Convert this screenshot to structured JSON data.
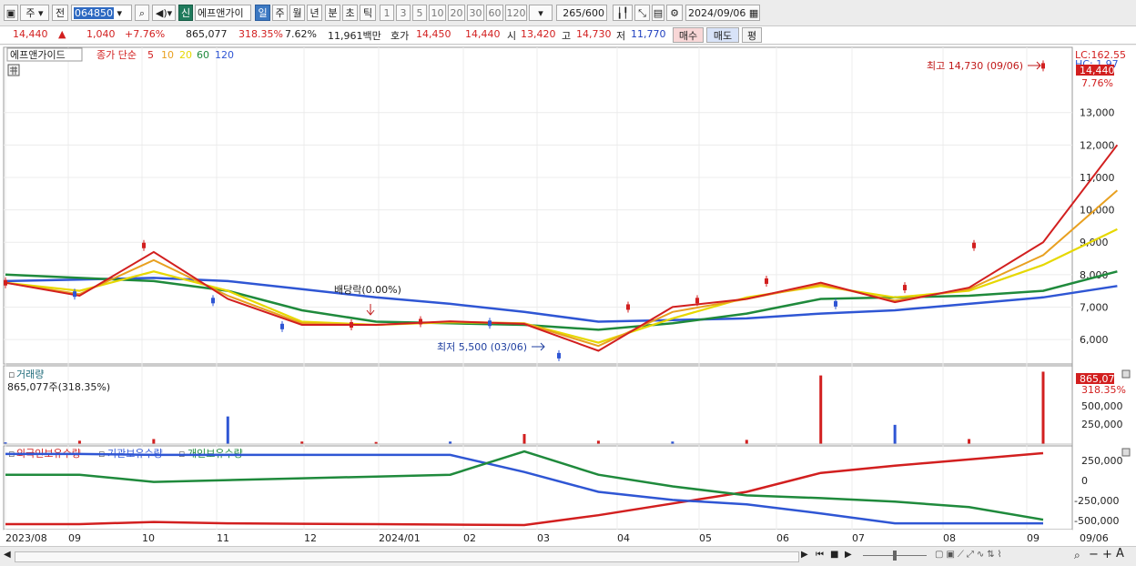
{
  "toolbar": {
    "market": "주",
    "prev": "전",
    "code": "064850",
    "badge": "신",
    "name": "에프앤가이",
    "periods": [
      "일",
      "주",
      "월",
      "년",
      "분",
      "초",
      "틱"
    ],
    "active_period": "일",
    "intervals": [
      "1",
      "3",
      "5",
      "10",
      "20",
      "30",
      "60",
      "120"
    ],
    "count": "265",
    "count_max": "/600",
    "date": "2024/09/06"
  },
  "quote": {
    "price": "14,440",
    "change": "1,040",
    "change_pct": "+7.76%",
    "volume": "865,077",
    "volume_ratio": "318.35%",
    "turnover": "7.62%",
    "amount": "11,961백만",
    "ask_label": "호가",
    "ask": "14,450",
    "bid": "14,440",
    "open_label": "시",
    "open": "13,420",
    "high_label": "고",
    "high": "14,730",
    "low_label": "저",
    "low": "11,770",
    "buy_button": "매수",
    "sell_button": "매도",
    "eval_button": "평"
  },
  "price_panel": {
    "name_tag": "에프앤가이드",
    "legend_prefix": "종가 단순",
    "legend_items": [
      {
        "label": "5",
        "color": "#d21f1f"
      },
      {
        "label": "10",
        "color": "#e8a020"
      },
      {
        "label": "20",
        "color": "#e6d800"
      },
      {
        "label": "60",
        "color": "#1f8a3c"
      },
      {
        "label": "120",
        "color": "#2f56d4"
      }
    ],
    "yaxis_labels": [
      "13,000",
      "12,000",
      "11,000",
      "10,000",
      "9,000",
      "8,000",
      "7,000",
      "6,000"
    ],
    "lc": "LC:162.55",
    "hc": "HC: 1.97",
    "last_tag": "14,440",
    "last_pct": "7.76%",
    "high_annotation": "최고 14,730 (09/06)",
    "low_annotation": "최저 5,500 (03/06)",
    "dividend_annotation": "배당락(0.00%)"
  },
  "volume_panel": {
    "title": "거래량",
    "value_label": "865,077주(318.35%)",
    "yaxis_labels": [
      "500,000",
      "250,000"
    ],
    "last_tag": "865,077",
    "last_pct": "318.35%"
  },
  "holding_panel": {
    "legend": [
      {
        "label": "외국인보유수량",
        "color": "#d21f1f"
      },
      {
        "label": "기관보유수량",
        "color": "#2f56d4"
      },
      {
        "label": "개인보유수량",
        "color": "#1f8a3c"
      }
    ],
    "yaxis_labels": [
      "250,000",
      "0",
      "-250,000",
      "-500,000"
    ]
  },
  "xaxis_labels": [
    "2023/08",
    "09",
    "10",
    "11",
    "12",
    "2024/01",
    "02",
    "03",
    "04",
    "05",
    "06",
    "07",
    "08",
    "09",
    "09/06"
  ],
  "chart_data": [
    {
      "type": "candlestick",
      "title": "에프앤가이드",
      "ylim": [
        5300,
        14900
      ],
      "x": [
        "2023/08",
        "09",
        "10",
        "11",
        "12",
        "2024/01",
        "02",
        "03",
        "04",
        "05",
        "06",
        "07",
        "08",
        "09",
        "09/06"
      ],
      "series": [
        {
          "name": "가격",
          "points": [
            {
              "x": "2023/08",
              "y": 7750
            },
            {
              "x": "09",
              "y": 7400
            },
            {
              "x": "09 중순",
              "y": 8900
            },
            {
              "x": "10",
              "y": 7200
            },
            {
              "x": "11",
              "y": 6400
            },
            {
              "x": "12",
              "y": 6450
            },
            {
              "x": "2024/01",
              "y": 6550
            },
            {
              "x": "02",
              "y": 6500
            },
            {
              "x": "03",
              "y": 5500
            },
            {
              "x": "04",
              "y": 7000
            },
            {
              "x": "05",
              "y": 7200
            },
            {
              "x": "06",
              "y": 7800
            },
            {
              "x": "07",
              "y": 7100
            },
            {
              "x": "08",
              "y": 7600
            },
            {
              "x": "09",
              "y": 8900
            },
            {
              "x": "09/06",
              "y": 14440
            }
          ]
        },
        {
          "name": "5",
          "values": [
            7750,
            7350,
            8700,
            7250,
            6450,
            6450,
            6560,
            6480,
            5650,
            7000,
            7250,
            7750,
            7150,
            7600,
            9000,
            12000
          ]
        },
        {
          "name": "10",
          "values": [
            7750,
            7400,
            8450,
            7350,
            6500,
            6450,
            6550,
            6500,
            5800,
            6850,
            7250,
            7700,
            7200,
            7550,
            8600,
            10600
          ]
        },
        {
          "name": "20",
          "values": [
            7750,
            7500,
            8100,
            7500,
            6550,
            6450,
            6530,
            6500,
            5900,
            6650,
            7300,
            7650,
            7300,
            7500,
            8300,
            9400
          ]
        },
        {
          "name": "60",
          "values": [
            8000,
            7900,
            7800,
            7500,
            6900,
            6550,
            6500,
            6450,
            6300,
            6500,
            6800,
            7250,
            7300,
            7350,
            7500,
            8100
          ]
        },
        {
          "name": "120",
          "values": [
            7800,
            7850,
            7900,
            7800,
            7550,
            7300,
            7100,
            6850,
            6550,
            6600,
            6650,
            6800,
            6900,
            7100,
            7300,
            7650
          ]
        }
      ]
    },
    {
      "type": "bar",
      "title": "거래량",
      "ylim": [
        0,
        870000
      ],
      "x": [
        "2023/08",
        "09",
        "10",
        "11",
        "12",
        "2024/01",
        "02",
        "03",
        "04",
        "05",
        "06",
        "07",
        "08",
        "09",
        "09/06"
      ],
      "values": [
        20000,
        40000,
        60000,
        330000,
        30000,
        25000,
        30000,
        120000,
        40000,
        30000,
        50000,
        820000,
        230000,
        60000,
        865077
      ]
    },
    {
      "type": "line",
      "title": "보유수량",
      "ylim": [
        -560000,
        310000
      ],
      "x": [
        "2023/08",
        "09",
        "10",
        "11",
        "12",
        "2024/01",
        "02",
        "03",
        "04",
        "05",
        "06",
        "07",
        "08",
        "09",
        "09/06"
      ],
      "series": [
        {
          "name": "외국인보유수량",
          "values": [
            -520000,
            -520000,
            -495000,
            -510000,
            -515000,
            -520000,
            -525000,
            -530000,
            -420000,
            -290000,
            -160000,
            50000,
            130000,
            200000,
            270000
          ]
        },
        {
          "name": "기관보유수량",
          "values": [
            260000,
            260000,
            250000,
            250000,
            250000,
            250000,
            250000,
            60000,
            -160000,
            -250000,
            -300000,
            -400000,
            -510000,
            -510000,
            -510000
          ]
        },
        {
          "name": "개인보유수량",
          "values": [
            30000,
            30000,
            -50000,
            -30000,
            -10000,
            10000,
            30000,
            290000,
            30000,
            -100000,
            -200000,
            -230000,
            -270000,
            -330000,
            -470000
          ]
        }
      ]
    }
  ]
}
